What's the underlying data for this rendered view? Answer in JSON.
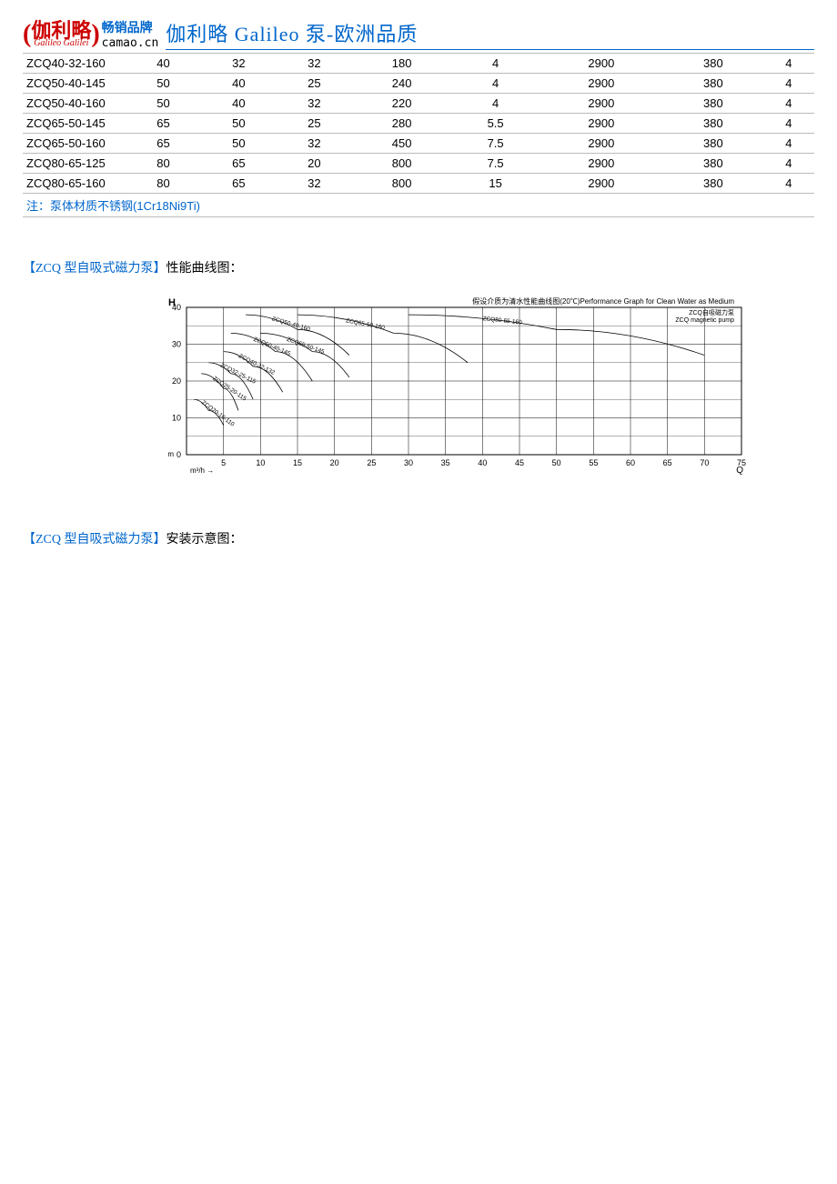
{
  "header": {
    "logo_cn": "伽利略",
    "logo_script": "Galileo Galilei",
    "logo_top": "畅销品牌",
    "logo_bottom": "camao.cn",
    "title": "伽利略 Galileo 泵-欧洲品质"
  },
  "table": {
    "rows": [
      [
        "ZCQ40-32-160",
        "40",
        "32",
        "32",
        "180",
        "4",
        "2900",
        "380",
        "4"
      ],
      [
        "ZCQ50-40-145",
        "50",
        "40",
        "25",
        "240",
        "4",
        "2900",
        "380",
        "4"
      ],
      [
        "ZCQ50-40-160",
        "50",
        "40",
        "32",
        "220",
        "4",
        "2900",
        "380",
        "4"
      ],
      [
        "ZCQ65-50-145",
        "65",
        "50",
        "25",
        "280",
        "5.5",
        "2900",
        "380",
        "4"
      ],
      [
        "ZCQ65-50-160",
        "65",
        "50",
        "32",
        "450",
        "7.5",
        "2900",
        "380",
        "4"
      ],
      [
        "ZCQ80-65-125",
        "80",
        "65",
        "20",
        "800",
        "7.5",
        "2900",
        "380",
        "4"
      ],
      [
        "ZCQ80-65-160",
        "80",
        "65",
        "32",
        "800",
        "15",
        "2900",
        "380",
        "4"
      ]
    ],
    "note": "注：泵体材质不锈钢(1Cr18Ni9Ti)"
  },
  "section1": {
    "bracket_open": "【",
    "model": "ZCQ 型自吸式磁力泵",
    "bracket_close": "】",
    "suffix": "性能曲线图："
  },
  "section2": {
    "bracket_open": "【",
    "model": "ZCQ 型自吸式磁力泵",
    "bracket_close": "】",
    "suffix": "安装示意图："
  },
  "chart_data": {
    "type": "line",
    "title": "假设介质为清水性能曲线图(20℃)Performance Graph for Clean Water as Medium",
    "legend": "ZCQ自吸磁力泵\nZCQ magnetic pump",
    "xlabel": "Q",
    "xunit": "m³/h",
    "ylabel": "H",
    "yunit": "m",
    "xlim": [
      0,
      75
    ],
    "ylim": [
      0,
      40
    ],
    "xticks": [
      5,
      10,
      15,
      20,
      25,
      30,
      35,
      40,
      45,
      50,
      55,
      60,
      65,
      70,
      75
    ],
    "yticks": [
      0,
      10,
      20,
      30,
      40
    ],
    "series": [
      {
        "name": "ZCQ20-16-110",
        "points": [
          [
            1,
            15
          ],
          [
            3,
            12
          ],
          [
            5,
            8
          ]
        ]
      },
      {
        "name": "ZCQ25-20-115",
        "points": [
          [
            2,
            22
          ],
          [
            5,
            18
          ],
          [
            7,
            12
          ]
        ]
      },
      {
        "name": "ZCQ32-25-115",
        "points": [
          [
            3,
            25
          ],
          [
            6,
            22
          ],
          [
            9,
            15
          ]
        ]
      },
      {
        "name": "ZCQ40-32-132",
        "points": [
          [
            5,
            28
          ],
          [
            9,
            24
          ],
          [
            13,
            17
          ]
        ]
      },
      {
        "name": "ZCQ50-40-145",
        "points": [
          [
            6,
            33
          ],
          [
            12,
            28
          ],
          [
            17,
            20
          ]
        ]
      },
      {
        "name": "ZCQ65-50-145",
        "points": [
          [
            10,
            33
          ],
          [
            17,
            28
          ],
          [
            22,
            21
          ]
        ]
      },
      {
        "name": "ZCQ50-40-160",
        "points": [
          [
            8,
            38
          ],
          [
            15,
            34
          ],
          [
            22,
            27
          ]
        ]
      },
      {
        "name": "ZCQ65-50-160",
        "points": [
          [
            15,
            38
          ],
          [
            28,
            33
          ],
          [
            38,
            25
          ]
        ]
      },
      {
        "name": "ZCQ80-65-160",
        "points": [
          [
            30,
            38
          ],
          [
            50,
            34
          ],
          [
            70,
            27
          ]
        ]
      }
    ]
  }
}
